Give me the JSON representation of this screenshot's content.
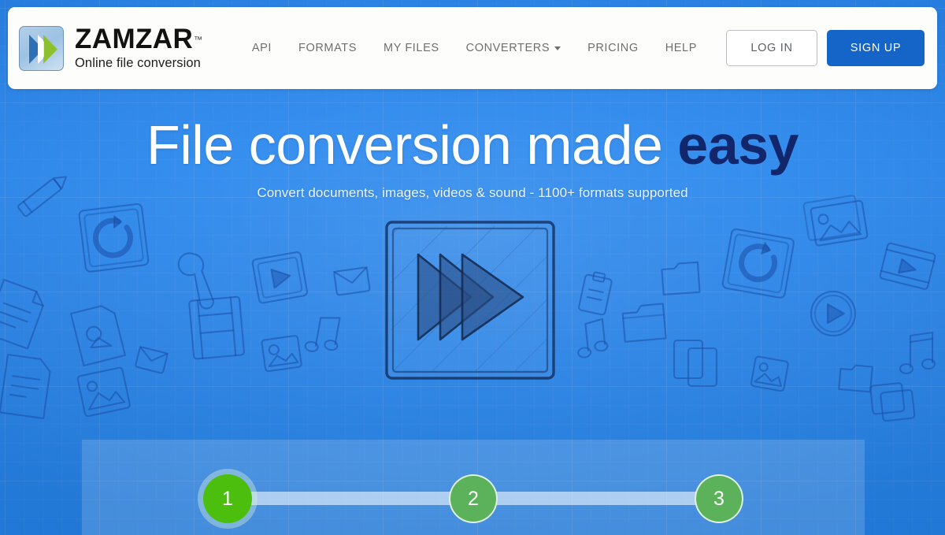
{
  "brand": {
    "name": "ZAMZAR",
    "trademark": "™",
    "tagline": "Online file conversion",
    "logo_icon": "double-chevron-icon",
    "logo_colors": {
      "chevron_blue": "#2f6fb5",
      "chevron_green": "#8ebf2e",
      "tile": "#a9c9e6"
    }
  },
  "nav": {
    "items": [
      {
        "label": "API",
        "name": "nav-api",
        "has_dropdown": false
      },
      {
        "label": "FORMATS",
        "name": "nav-formats",
        "has_dropdown": false
      },
      {
        "label": "MY FILES",
        "name": "nav-my-files",
        "has_dropdown": false
      },
      {
        "label": "CONVERTERS",
        "name": "nav-converters",
        "has_dropdown": true,
        "caret_icon": "chevron-down-icon"
      },
      {
        "label": "PRICING",
        "name": "nav-pricing",
        "has_dropdown": false
      },
      {
        "label": "HELP",
        "name": "nav-help",
        "has_dropdown": false
      }
    ],
    "login_label": "LOG IN",
    "signup_label": "SIGN UP",
    "link_color": "#6f6f70",
    "signup_color": "#1565c9"
  },
  "hero": {
    "title_main": "File conversion made ",
    "title_accent": "easy",
    "subtitle": "Convert documents, images, videos & sound - 1100+ formats supported",
    "accent_color": "#12276b",
    "background_color": "#2f86e6",
    "illustration_icon": "fast-forward-arrows-sketch-icon"
  },
  "steps": {
    "items": [
      {
        "number": "1",
        "state": "active",
        "name": "step-1"
      },
      {
        "number": "2",
        "state": "idle",
        "name": "step-2"
      },
      {
        "number": "3",
        "state": "idle",
        "name": "step-3"
      }
    ],
    "active_color": "#4cbf0e",
    "idle_color": "#5cb25b"
  },
  "doodle_icons": [
    "pencil-icon",
    "refresh-circle-icon",
    "document-icon",
    "envelope-icon",
    "image-icon",
    "film-strip-icon",
    "play-circle-icon",
    "music-note-icon",
    "folder-icon",
    "photo-stack-icon",
    "video-frame-icon",
    "clipboard-icon"
  ]
}
